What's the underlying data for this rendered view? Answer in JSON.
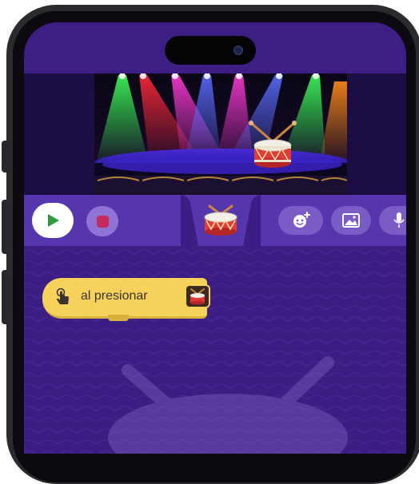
{
  "toolbar": {
    "play_icon": "play-icon",
    "stop_icon": "stop-icon",
    "selected_sprite_icon": "drum-icon",
    "actions": [
      "add-character-icon",
      "background-image-icon",
      "microphone-icon"
    ]
  },
  "event_block": {
    "label": "al presionar",
    "trigger_icon": "tap-hand-icon",
    "sprite_icon": "drum-icon"
  },
  "stage": {
    "scene": "concert-stage",
    "sprite": "drum-icon"
  },
  "colors": {
    "background": "#3b1d83",
    "toolbar": "#5536ad",
    "event_block": "#f6d25b",
    "play": "#2e9b3f",
    "stop": "#c62a5c"
  }
}
